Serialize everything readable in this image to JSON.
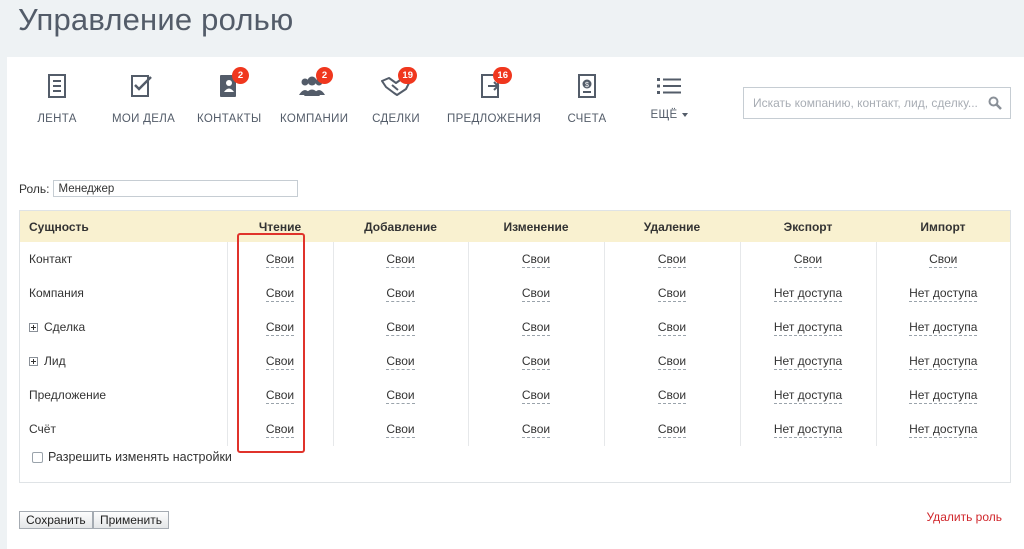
{
  "page": {
    "title": "Управление ролью"
  },
  "toolbar": {
    "items": [
      {
        "label": "ЛЕНТА",
        "icon": "feed-icon",
        "badge": ""
      },
      {
        "label": "МОИ ДЕЛА",
        "icon": "tasks-icon",
        "badge": ""
      },
      {
        "label": "КОНТАКТЫ",
        "icon": "contacts-icon",
        "badge": "2"
      },
      {
        "label": "КОМПАНИИ",
        "icon": "companies-icon",
        "badge": "2"
      },
      {
        "label": "СДЕЛКИ",
        "icon": "deals-icon",
        "badge": "19"
      },
      {
        "label": "ПРЕДЛОЖЕНИЯ",
        "icon": "quotes-icon",
        "badge": "16"
      },
      {
        "label": "СЧЕТА",
        "icon": "invoices-icon",
        "badge": ""
      },
      {
        "label": "ЕЩЁ",
        "icon": "list-icon",
        "badge": ""
      }
    ],
    "search_placeholder": "Искать компанию, контакт, лид, сделку..."
  },
  "role": {
    "label": "Роль:",
    "value": "Менеджер"
  },
  "table": {
    "headers": [
      "Сущность",
      "Чтение",
      "Добавление",
      "Изменение",
      "Удаление",
      "Экспорт",
      "Импорт"
    ],
    "rows": [
      {
        "entity": "Контакт",
        "expandable": false,
        "cells": [
          "Свои",
          "Свои",
          "Свои",
          "Свои",
          "Свои",
          "Свои"
        ]
      },
      {
        "entity": "Компания",
        "expandable": false,
        "cells": [
          "Свои",
          "Свои",
          "Свои",
          "Свои",
          "Нет доступа",
          "Нет доступа"
        ]
      },
      {
        "entity": "Сделка",
        "expandable": true,
        "cells": [
          "Свои",
          "Свои",
          "Свои",
          "Свои",
          "Нет доступа",
          "Нет доступа"
        ]
      },
      {
        "entity": "Лид",
        "expandable": true,
        "cells": [
          "Свои",
          "Свои",
          "Свои",
          "Свои",
          "Нет доступа",
          "Нет доступа"
        ]
      },
      {
        "entity": "Предложение",
        "expandable": false,
        "cells": [
          "Свои",
          "Свои",
          "Свои",
          "Свои",
          "Нет доступа",
          "Нет доступа"
        ]
      },
      {
        "entity": "Счёт",
        "expandable": false,
        "cells": [
          "Свои",
          "Свои",
          "Свои",
          "Свои",
          "Нет доступа",
          "Нет доступа"
        ]
      }
    ]
  },
  "allow_settings": {
    "label": "Разрешить изменять настройки",
    "checked": false
  },
  "buttons": {
    "save": "Сохранить",
    "apply": "Применить",
    "delete": "Удалить роль"
  },
  "colors": {
    "badge": "#f0371e",
    "header_bg": "#f9f1d0",
    "highlight": "#e0332b",
    "delete_link": "#d0262b"
  }
}
